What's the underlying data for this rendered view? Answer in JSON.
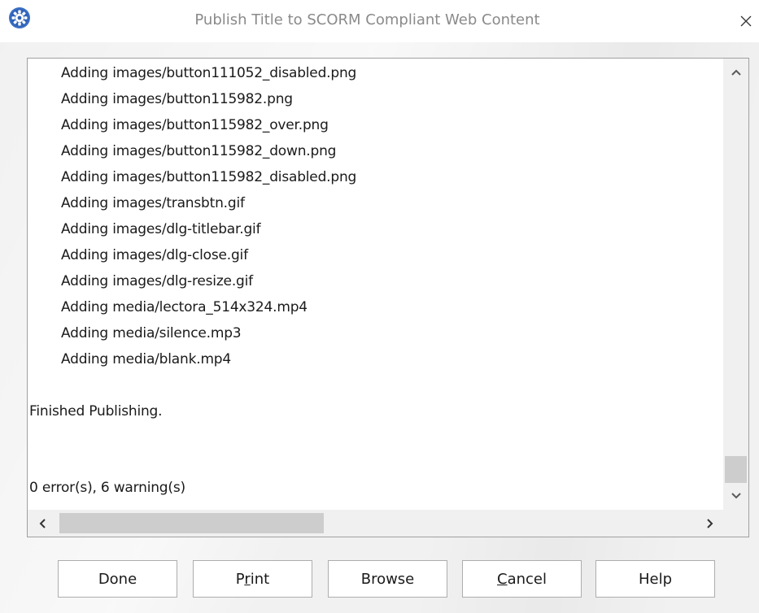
{
  "window": {
    "title": "Publish Title to SCORM Compliant Web Content",
    "close_glyph": "×"
  },
  "log": {
    "lines": [
      "Adding images/button111052_disabled.png",
      "Adding images/button115982.png",
      "Adding images/button115982_over.png",
      "Adding images/button115982_down.png",
      "Adding images/button115982_disabled.png",
      "Adding images/transbtn.gif",
      "Adding images/dlg-titlebar.gif",
      "Adding images/dlg-close.gif",
      "Adding images/dlg-resize.gif",
      "Adding media/lectora_514x324.mp4",
      "Adding media/silence.mp3",
      "Adding media/blank.mp4"
    ],
    "finished": "Finished Publishing.",
    "summary": "0 error(s), 6 warning(s)"
  },
  "buttons": {
    "done": "Done",
    "print_pre": "P",
    "print_key": "r",
    "print_post": "int",
    "browse": "Browse",
    "cancel_key": "C",
    "cancel_post": "ancel",
    "help": "Help"
  },
  "icons": {
    "app": "gear-icon",
    "close": "close-icon",
    "scroll_up": "chevron-up-icon",
    "scroll_down": "chevron-down-icon",
    "scroll_left": "chevron-left-icon",
    "scroll_right": "chevron-right-icon"
  },
  "colors": {
    "app_icon": "#3a6fc4",
    "title_text": "#8a8a8a"
  }
}
